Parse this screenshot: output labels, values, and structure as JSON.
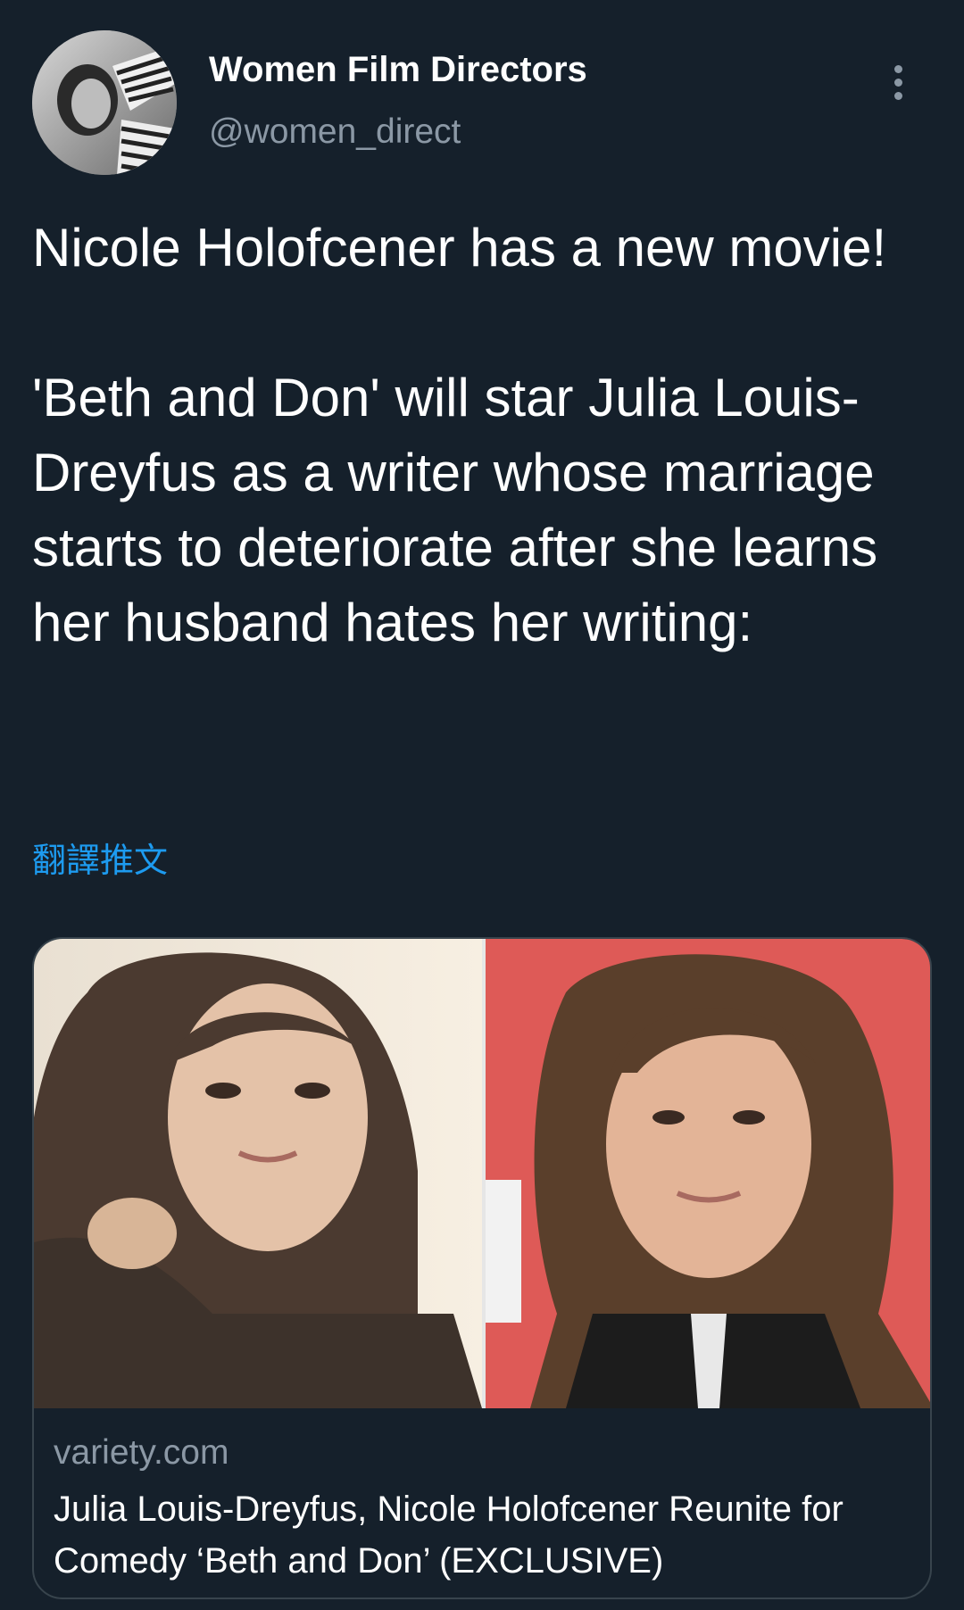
{
  "author": {
    "display_name": "Women Film Directors",
    "handle": "@women_direct",
    "avatar_icon": "profile-photo"
  },
  "more_icon": "vertical-ellipsis-icon",
  "tweet": {
    "text": "Nicole Holofcener has a new movie!\n\n'Beth and Don' will star Julia Louis-Dreyfus as a writer whose marriage starts to deteriorate after she learns her husband hates her writing:",
    "translate_label": "翻譯推文"
  },
  "link_card": {
    "domain": "variety.com",
    "title": "Julia Louis-Dreyfus, Nicole Holofcener Reunite for Comedy ‘Beth and Don’ (EXCLUSIVE)"
  },
  "colors": {
    "background": "#15202b",
    "text": "#ffffff",
    "secondary_text": "#8b98a5",
    "link": "#1d9bf0",
    "border": "#38444d"
  }
}
